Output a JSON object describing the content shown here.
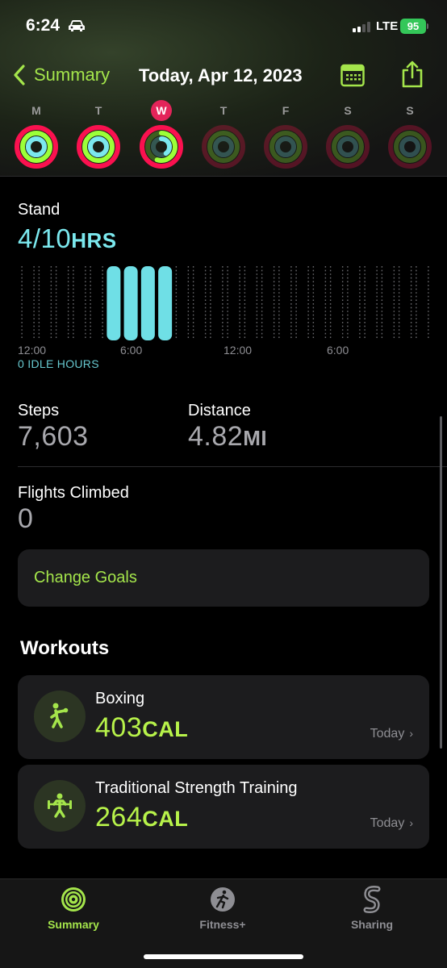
{
  "status_bar": {
    "time": "6:24",
    "network": "LTE",
    "battery": "95"
  },
  "nav": {
    "back_label": "Summary",
    "title": "Today, Apr 12, 2023"
  },
  "week": {
    "days": [
      {
        "letter": "M",
        "today": false,
        "move": 1.1,
        "exercise": 1.0,
        "stand": 1.0
      },
      {
        "letter": "T",
        "today": false,
        "move": 1.2,
        "exercise": 1.0,
        "stand": 1.0
      },
      {
        "letter": "W",
        "today": true,
        "move": 1.0,
        "exercise": 0.55,
        "stand": 0.4
      },
      {
        "letter": "T",
        "today": false,
        "move": 0,
        "exercise": 0,
        "stand": 0
      },
      {
        "letter": "F",
        "today": false,
        "move": 0,
        "exercise": 0,
        "stand": 0
      },
      {
        "letter": "S",
        "today": false,
        "move": 0,
        "exercise": 0,
        "stand": 0
      },
      {
        "letter": "S",
        "today": false,
        "move": 0,
        "exercise": 0,
        "stand": 0
      }
    ]
  },
  "stand": {
    "label": "Stand",
    "value": "4/10",
    "unit": "HRS",
    "idle_text": "0 IDLE HOURS",
    "ticks": [
      "12:00",
      "6:00",
      "12:00",
      "6:00"
    ]
  },
  "chart_data": {
    "type": "bar",
    "categories": [
      "0",
      "1",
      "2",
      "3",
      "4",
      "5",
      "6",
      "7",
      "8",
      "9",
      "10",
      "11",
      "12",
      "13",
      "14",
      "15",
      "16",
      "17",
      "18",
      "19",
      "20",
      "21",
      "22",
      "23"
    ],
    "values": [
      0,
      0,
      0,
      0,
      0,
      1,
      1,
      1,
      1,
      0,
      0,
      0,
      0,
      0,
      0,
      0,
      0,
      0,
      0,
      0,
      0,
      0,
      0,
      0
    ],
    "title": "",
    "xlabel": "",
    "ylabel": "",
    "ylim": [
      0,
      1
    ],
    "grid": false
  },
  "stats": {
    "steps": {
      "label": "Steps",
      "value": "7,603"
    },
    "distance": {
      "label": "Distance",
      "value": "4.82",
      "unit": "MI"
    },
    "flights": {
      "label": "Flights Climbed",
      "value": "0"
    }
  },
  "change_goals": "Change Goals",
  "workouts": {
    "title": "Workouts",
    "items": [
      {
        "name": "Boxing",
        "value": "403",
        "unit": "CAL",
        "date": "Today",
        "icon": "boxing-icon"
      },
      {
        "name": "Traditional Strength Training",
        "value": "264",
        "unit": "CAL",
        "date": "Today",
        "icon": "strength-training-icon"
      }
    ]
  },
  "tabs": [
    {
      "label": "Summary",
      "icon": "activity-rings-icon",
      "active": true
    },
    {
      "label": "Fitness+",
      "icon": "fitness-plus-icon",
      "active": false
    },
    {
      "label": "Sharing",
      "icon": "sharing-icon",
      "active": false
    }
  ],
  "colors": {
    "accent": "#a4e54b",
    "stand": "#7be8ee",
    "move": "#fa114f",
    "exercise": "#9cff38",
    "today": "#e3245a"
  }
}
